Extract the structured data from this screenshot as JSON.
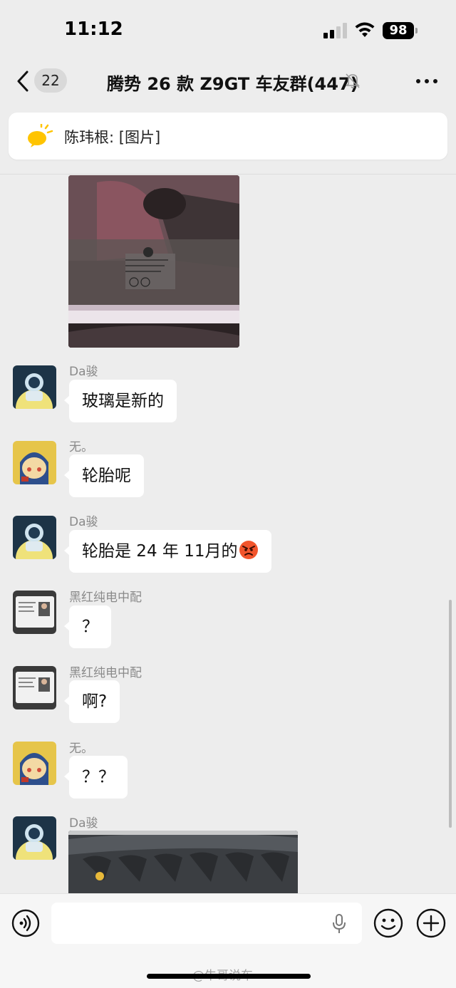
{
  "status_bar": {
    "time": "11:12",
    "battery": "98"
  },
  "nav": {
    "unread_count": "22",
    "title": "腾势 26 款 Z9GT 车友群(447)"
  },
  "pinned": {
    "text": "陈玮根: [图片]"
  },
  "messages": [
    {
      "type": "image",
      "sender": "",
      "content": ""
    },
    {
      "type": "text",
      "sender": "Da骏",
      "content": "玻璃是新的"
    },
    {
      "type": "text",
      "sender": "无。",
      "content": "轮胎呢"
    },
    {
      "type": "text",
      "sender": "Da骏",
      "content": "轮胎是 24 年 11月的",
      "emoji": "angry-face-icon"
    },
    {
      "type": "text",
      "sender": "黑红纯电中配",
      "content": "？"
    },
    {
      "type": "text",
      "sender": "黑红纯电中配",
      "content": "啊?"
    },
    {
      "type": "text",
      "sender": "无。",
      "content": "？？"
    },
    {
      "type": "image",
      "sender": "Da骏",
      "content": ""
    }
  ],
  "input": {
    "placeholder": ""
  },
  "watermark": "@牛哥说车",
  "colors": {
    "background": "#ededed",
    "bubble": "#ffffff",
    "sender_name": "#8a8a8a",
    "badge": "#d9d9d9"
  }
}
